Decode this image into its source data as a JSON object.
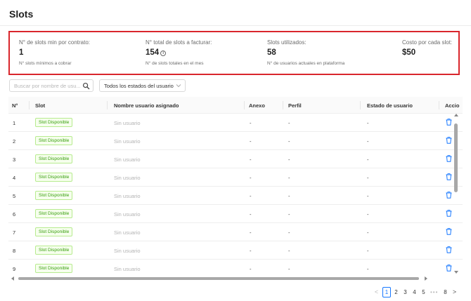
{
  "page": {
    "title": "Slots"
  },
  "summary": {
    "min_slots": {
      "label": "N° de slots min por contrato:",
      "value": "1",
      "sub": "N° slots mínimos a cobrar"
    },
    "total_slots": {
      "label": "N° total de slots a facturar:",
      "value": "154",
      "info_icon": "info-circle-icon",
      "sub": "N° de slots totales en el mes"
    },
    "used_slots": {
      "label": "Slots utilizados:",
      "value": "58",
      "sub": "N° de usuarios actuales en plataforma"
    },
    "cost": {
      "label": "Costo por cada slot:",
      "value": "$50"
    },
    "highlight_color": "#d9262c"
  },
  "filters": {
    "search_placeholder": "Buscar por nombre de usu...",
    "search_icon": "search-icon",
    "status_select": "Todos los estados del usuario",
    "status_icon": "chevron-down-icon"
  },
  "table": {
    "headers": {
      "num": "N°",
      "slot": "Slot",
      "user": "Nombre usuario asignado",
      "anexo": "Anexo",
      "perfil": "Perfil",
      "estado": "Estado de usuario",
      "acciones": "Accio"
    },
    "rows": [
      {
        "num": "1",
        "slot": "Slot Disponible",
        "user": "Sin usuario",
        "anexo": "-",
        "perfil": "-",
        "estado": "-"
      },
      {
        "num": "2",
        "slot": "Slot Disponible",
        "user": "Sin usuario",
        "anexo": "-",
        "perfil": "-",
        "estado": "-"
      },
      {
        "num": "3",
        "slot": "Slot Disponible",
        "user": "Sin usuario",
        "anexo": "-",
        "perfil": "-",
        "estado": "-"
      },
      {
        "num": "4",
        "slot": "Slot Disponible",
        "user": "Sin usuario",
        "anexo": "-",
        "perfil": "-",
        "estado": "-"
      },
      {
        "num": "5",
        "slot": "Slot Disponible",
        "user": "Sin usuario",
        "anexo": "-",
        "perfil": "-",
        "estado": "-"
      },
      {
        "num": "6",
        "slot": "Slot Disponible",
        "user": "Sin usuario",
        "anexo": "-",
        "perfil": "-",
        "estado": "-"
      },
      {
        "num": "7",
        "slot": "Slot Disponible",
        "user": "Sin usuario",
        "anexo": "-",
        "perfil": "-",
        "estado": "-"
      },
      {
        "num": "8",
        "slot": "Slot Disponible",
        "user": "Sin usuario",
        "anexo": "-",
        "perfil": "-",
        "estado": "-"
      },
      {
        "num": "9",
        "slot": "Slot Disponible",
        "user": "Sin usuario",
        "anexo": "-",
        "perfil": "-",
        "estado": "-"
      }
    ],
    "action_icon": "trash-icon",
    "tag_color": "#389e0d",
    "action_color": "#1677ff"
  },
  "pagination": {
    "prev": "<",
    "pages": [
      "1",
      "2",
      "3",
      "4",
      "5"
    ],
    "ellipsis": "•••",
    "last": "8",
    "next": ">",
    "current": "1"
  }
}
